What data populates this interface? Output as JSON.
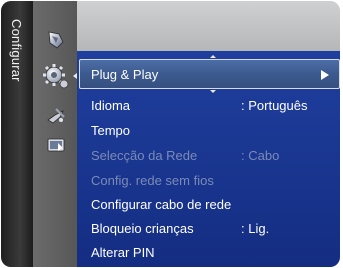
{
  "side_tab": {
    "label": "Configurar"
  },
  "category_icons": [
    {
      "name": "picture-icon"
    },
    {
      "name": "setup-gear-icon",
      "active": true
    },
    {
      "name": "satellite-icon"
    },
    {
      "name": "input-icon"
    }
  ],
  "menu": {
    "selected": {
      "label": "Plug & Play"
    },
    "items": [
      {
        "label": "Idioma",
        "value": ": Português",
        "enabled": true
      },
      {
        "label": "Tempo",
        "value": "",
        "enabled": true
      },
      {
        "label": "Selecção da Rede",
        "value": ": Cabo",
        "enabled": false
      },
      {
        "label": "Config. rede sem fios",
        "value": "",
        "enabled": false
      },
      {
        "label": "Configurar cabo de rede",
        "value": "",
        "enabled": true
      },
      {
        "label": "Bloqueio crianças",
        "value": ": Lig.",
        "enabled": true
      },
      {
        "label": "Alterar PIN",
        "value": "",
        "enabled": true
      }
    ]
  },
  "colors": {
    "menu_bg": "#1a3790",
    "highlight_bg": "#4466a0",
    "disabled_text": "#7b8bb5",
    "text": "#ffffff"
  }
}
